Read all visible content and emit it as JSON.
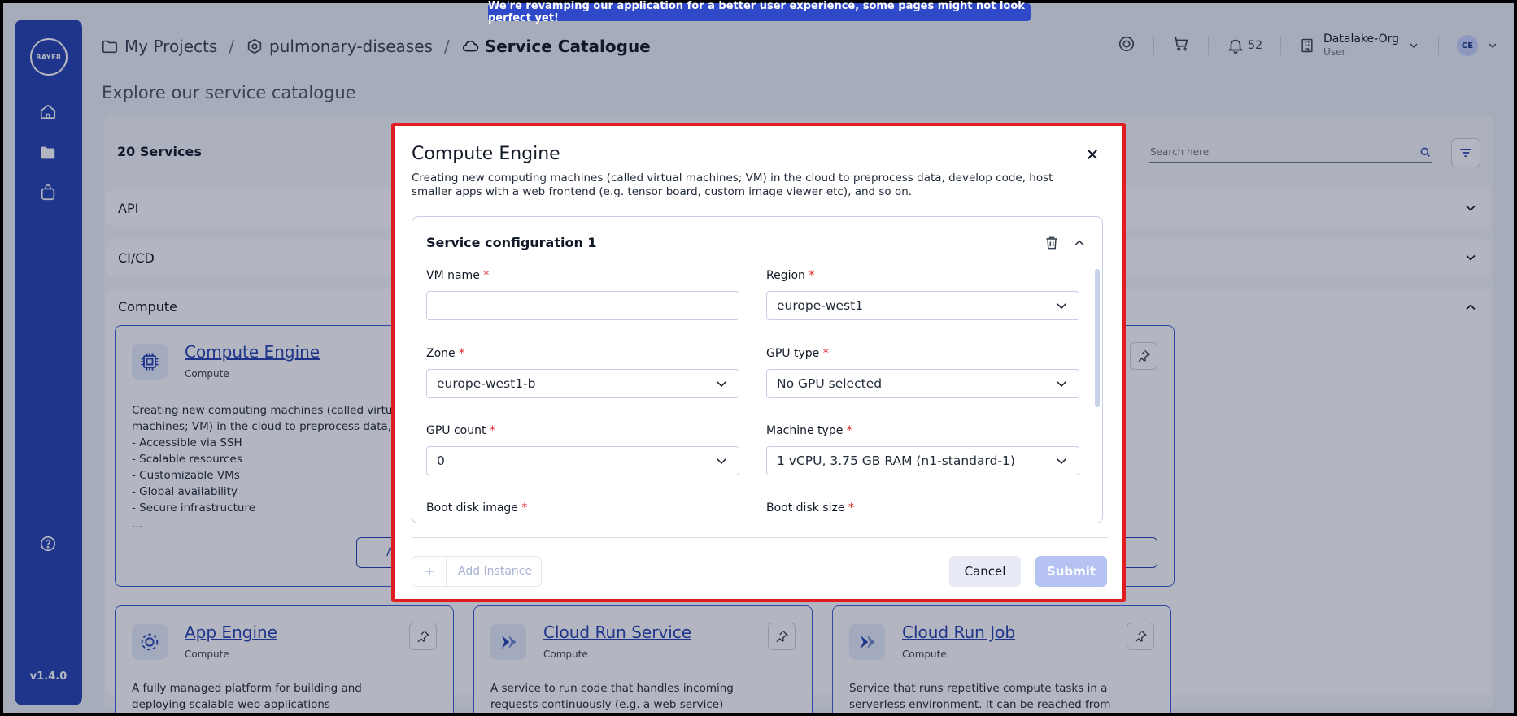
{
  "banner": "We're revamping our application for a better user experience, some pages might not look perfect yet!",
  "sidebar": {
    "logo_text": "BAYER",
    "version": "v1.4.0"
  },
  "breadcrumb": {
    "items": [
      "My Projects",
      "pulmonary-diseases",
      "Service Catalogue"
    ],
    "separator": "/"
  },
  "header": {
    "notifications_count": "52",
    "org_name": "Datalake-Org",
    "org_role": "User",
    "avatar_initials": "CE"
  },
  "page": {
    "title": "Explore our service catalogue",
    "service_count": "20 Services",
    "search_placeholder": "Search here"
  },
  "accordions": [
    "API",
    "CI/CD",
    "Compute"
  ],
  "cards": [
    {
      "title": "Compute Engine",
      "category": "Compute",
      "desc_lines": [
        "Creating new computing machines (called virtual",
        "machines; VM) in the cloud to preprocess data,..."
      ],
      "features": [
        "-   Accessible via SSH",
        "-   Scalable resources",
        "-   Customizable VMs",
        "-   Global availability",
        "-   Secure infrastructure",
        "..."
      ],
      "button": "A"
    },
    {
      "title": "App Engine",
      "category": "Compute",
      "desc_lines": [
        "A fully managed platform for building and",
        "deploying scalable web applications"
      ]
    },
    {
      "title": "Cloud Run Service",
      "category": "Compute",
      "desc_lines": [
        "A service to run code that handles incoming",
        "requests continuously (e.g. a web service)"
      ]
    },
    {
      "title": "Cloud Run Job",
      "category": "Compute",
      "desc_lines": [
        "Service that runs repetitive compute tasks in a",
        "serverless environment. It can be reached from"
      ]
    }
  ],
  "modal": {
    "title": "Compute Engine",
    "description": "Creating new computing machines (called virtual machines; VM) in the cloud to preprocess data, develop code, host smaller apps with a web frontend (e.g. tensor board, custom image viewer etc), and so on.",
    "config_title": "Service configuration 1",
    "fields": {
      "vm_name": {
        "label": "VM name",
        "value": ""
      },
      "region": {
        "label": "Region",
        "value": "europe-west1"
      },
      "zone": {
        "label": "Zone",
        "value": "europe-west1-b"
      },
      "gpu_type": {
        "label": "GPU type",
        "value": "No GPU selected"
      },
      "gpu_count": {
        "label": "GPU count",
        "value": "0"
      },
      "machine_type": {
        "label": "Machine type",
        "value": "1 vCPU, 3.75 GB RAM (n1-standard-1)"
      },
      "boot_disk_image": {
        "label": "Boot disk image"
      },
      "boot_disk_size": {
        "label": "Boot disk size"
      }
    },
    "required_marker": "*",
    "add_instance": "Add Instance",
    "cancel": "Cancel",
    "submit": "Submit"
  },
  "colors": {
    "sidebar": "#2541b2",
    "accent": "#2541b2",
    "modal_border": "#e11d22",
    "submit_disabled": "#b6c3f2"
  }
}
